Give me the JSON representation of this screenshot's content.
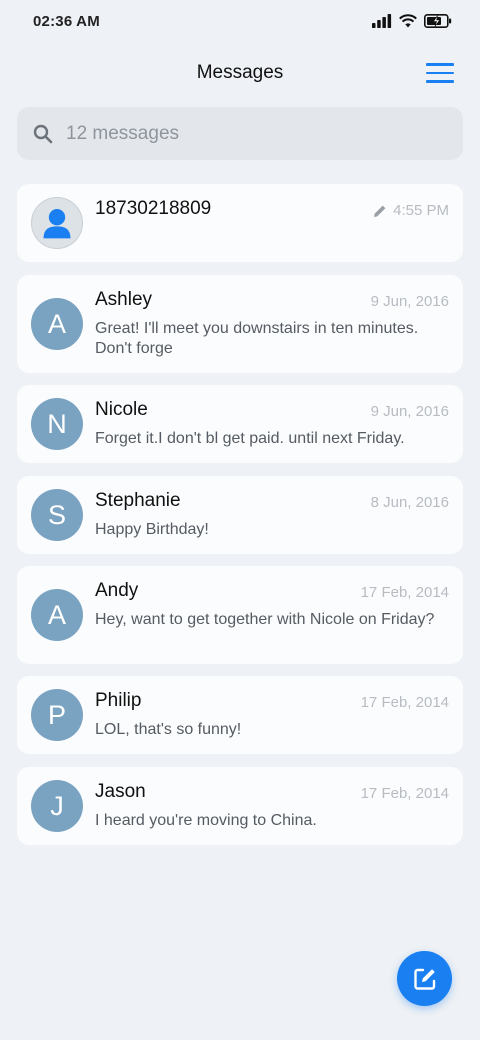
{
  "status_bar": {
    "time": "02:36 AM",
    "icons": [
      "signal-icon",
      "wifi-icon",
      "battery-charging-icon"
    ]
  },
  "header": {
    "title": "Messages",
    "menu_icon": "hamburger-menu-icon"
  },
  "search": {
    "placeholder": "12 messages",
    "icon": "search-icon"
  },
  "conversations": [
    {
      "name": "18730218809",
      "initial": "",
      "avatar": "default-person-icon",
      "date": "4:55 PM",
      "draft_icon": "pencil-icon",
      "preview": ""
    },
    {
      "name": "Ashley",
      "initial": "A",
      "date": "9 Jun, 2016",
      "preview": "Great! I'll meet you downstairs in ten minutes. Don't forge"
    },
    {
      "name": "Nicole",
      "initial": "N",
      "date": "9 Jun, 2016",
      "preview": "Forget it.I don't bl get paid. until next Friday."
    },
    {
      "name": "Stephanie",
      "initial": "S",
      "date": "8 Jun, 2016",
      "preview": "Happy Birthday!"
    },
    {
      "name": "Andy",
      "initial": "A",
      "date": "17 Feb, 2014",
      "preview": "Hey, want to get together with Nicole on Friday?"
    },
    {
      "name": "Philip",
      "initial": "P",
      "date": "17 Feb, 2014",
      "preview": "LOL, that's so funny!"
    },
    {
      "name": "Jason",
      "initial": "J",
      "date": "17 Feb, 2014",
      "preview": "I heard you're moving to China."
    }
  ],
  "fab": {
    "icon": "compose-icon"
  },
  "colors": {
    "accent": "#1a7ff0",
    "avatar": "#7aa3c2",
    "background": "#eef1f5",
    "card": "#fbfcfd"
  }
}
